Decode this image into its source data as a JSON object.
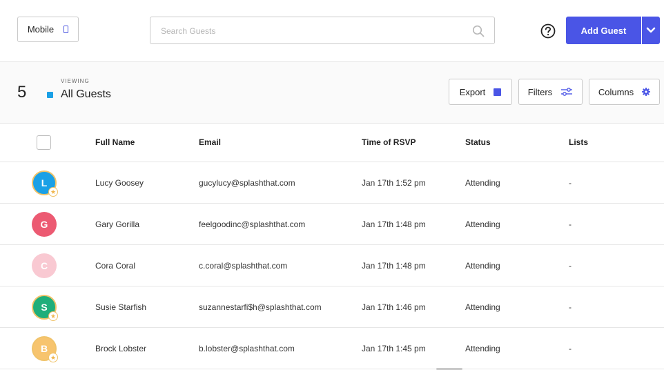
{
  "toolbar": {
    "mobile_label": "Mobile",
    "search_placeholder": "Search Guests",
    "add_guest_label": "Add Guest"
  },
  "summary": {
    "count": "5",
    "viewing_label": "VIEWING",
    "view_name": "All Guests",
    "view_color": "#1aa0e6"
  },
  "actions": {
    "export_label": "Export",
    "filters_label": "Filters",
    "columns_label": "Columns"
  },
  "table": {
    "headers": {
      "name": "Full Name",
      "email": "Email",
      "time": "Time of RSVP",
      "status": "Status",
      "lists": "Lists"
    },
    "rows": [
      {
        "initial": "L",
        "color": "#1aa0e6",
        "starred": true,
        "name": "Lucy Goosey",
        "email": "gucylucy@splashthat.com",
        "time": "Jan 17th 1:52 pm",
        "status": "Attending",
        "lists": "-"
      },
      {
        "initial": "G",
        "color": "#ec5a72",
        "starred": false,
        "name": "Gary Gorilla",
        "email": "feelgoodinc@splashthat.com",
        "time": "Jan 17th 1:48 pm",
        "status": "Attending",
        "lists": "-"
      },
      {
        "initial": "C",
        "color": "#f9c9d2",
        "starred": false,
        "name": "Cora Coral",
        "email": "c.coral@splashthat.com",
        "time": "Jan 17th 1:48 pm",
        "status": "Attending",
        "lists": "-"
      },
      {
        "initial": "S",
        "color": "#1fae7a",
        "starred": true,
        "name": "Susie Starfish",
        "email": "suzannestarfi$h@splashthat.com",
        "time": "Jan 17th 1:46 pm",
        "status": "Attending",
        "lists": "-"
      },
      {
        "initial": "B",
        "color": "#f7c46e",
        "starred": true,
        "name": "Brock Lobster",
        "email": "b.lobster@splashthat.com",
        "time": "Jan 17th 1:45 pm",
        "status": "Attending",
        "lists": "-"
      }
    ]
  },
  "colors": {
    "accent": "#4a55e6",
    "star": "#f0c36a"
  },
  "icons": {
    "mobile": "phone-icon",
    "search": "search-icon",
    "help": "help-circle-icon",
    "caret": "chevron-down-icon",
    "export": "square-icon",
    "filters": "sliders-icon",
    "columns": "gear-icon",
    "badge": "star-icon"
  }
}
